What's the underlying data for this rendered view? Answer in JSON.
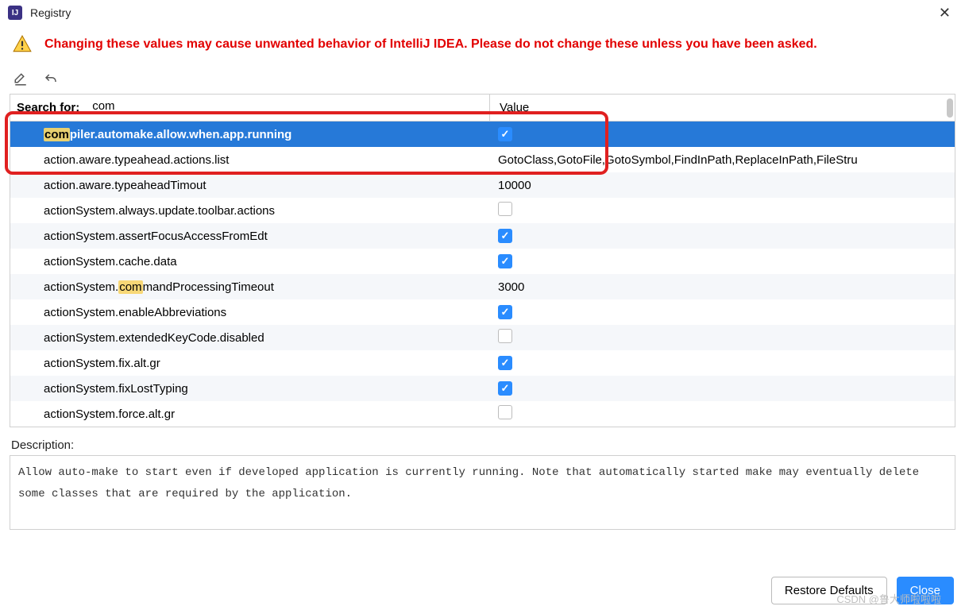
{
  "window": {
    "title": "Registry"
  },
  "warning": "Changing these values may cause unwanted behavior of IntelliJ IDEA. Please do not change these unless you have been asked.",
  "search": {
    "label": "Search for:",
    "value": "com",
    "value_header": "Value"
  },
  "rows": [
    {
      "keyPre": "",
      "keyHi": "com",
      "keyPost": "piler.automake.allow.when.app.running",
      "type": "check",
      "checked": true,
      "selected": true
    },
    {
      "keyPre": "action.aware.typeahead.actions.list",
      "type": "text",
      "value": "GotoClass,GotoFile,GotoSymbol,FindInPath,ReplaceInPath,FileStru"
    },
    {
      "keyPre": "action.aware.typeaheadTimout",
      "type": "text",
      "value": "10000"
    },
    {
      "keyPre": "actionSystem.always.update.toolbar.actions",
      "type": "check",
      "checked": false
    },
    {
      "keyPre": "actionSystem.assertFocusAccessFromEdt",
      "type": "check",
      "checked": true
    },
    {
      "keyPre": "actionSystem.cache.data",
      "type": "check",
      "checked": true
    },
    {
      "keyPre": "actionSystem.",
      "keyHi": "com",
      "keyPost": "mandProcessingTimeout",
      "type": "text",
      "value": "3000"
    },
    {
      "keyPre": "actionSystem.enableAbbreviations",
      "type": "check",
      "checked": true
    },
    {
      "keyPre": "actionSystem.extendedKeyCode.disabled",
      "type": "check",
      "checked": false
    },
    {
      "keyPre": "actionSystem.fix.alt.gr",
      "type": "check",
      "checked": true
    },
    {
      "keyPre": "actionSystem.fixLostTyping",
      "type": "check",
      "checked": true
    },
    {
      "keyPre": "actionSystem.force.alt.gr",
      "type": "check",
      "checked": false
    }
  ],
  "description": {
    "label": "Description:",
    "text": "Allow auto-make to start even if developed application is currently running. Note that automatically started make may eventually delete some classes that are required by the application."
  },
  "buttons": {
    "restore": "Restore Defaults",
    "close": "Close"
  },
  "watermark": "CSDN @鲁大师啦啦啦"
}
